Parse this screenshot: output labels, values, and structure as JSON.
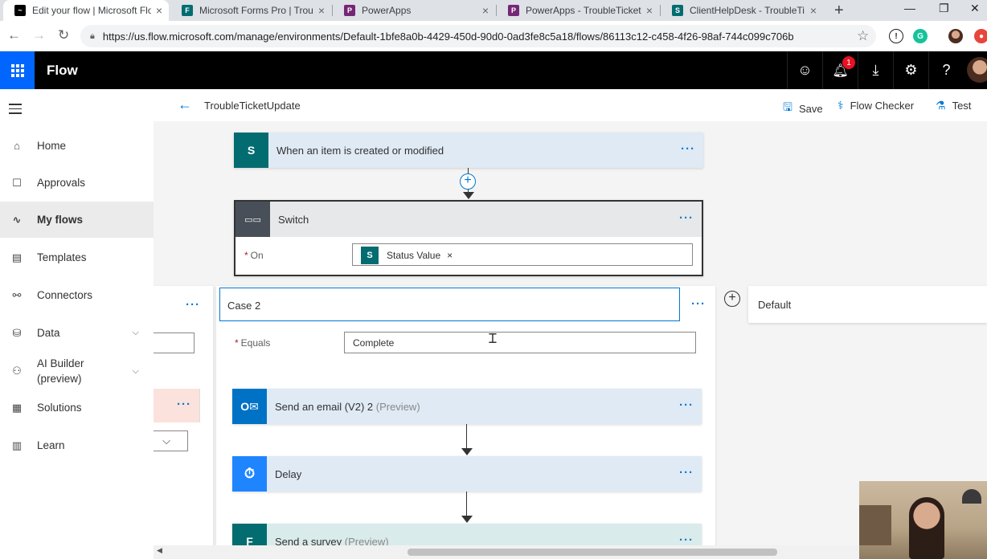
{
  "browser": {
    "tabs": [
      {
        "label": "Edit your flow | Microsoft Flow",
        "color": "#000000",
        "glyph": "~"
      },
      {
        "label": "Microsoft Forms Pro | Trouble",
        "color": "#036c70",
        "glyph": "F"
      },
      {
        "label": "PowerApps",
        "color": "#742774",
        "glyph": "P"
      },
      {
        "label": "PowerApps - TroubleTickets",
        "color": "#742774",
        "glyph": "P"
      },
      {
        "label": "ClientHelpDesk - TroubleTi",
        "color": "#036c70",
        "glyph": "S"
      }
    ],
    "url": "https://us.flow.microsoft.com/manage/environments/Default-1bfe8a0b-4429-450d-90d0-0ad3fe8c5a18/flows/86113c12-c458-4f26-98af-744c099c706b"
  },
  "header": {
    "app_name": "Flow",
    "notification_count": "1"
  },
  "nav": {
    "items": [
      {
        "label": "Home",
        "icon": "⌂"
      },
      {
        "label": "Approvals",
        "icon": "☐"
      },
      {
        "label": "My flows",
        "icon": "∿"
      },
      {
        "label": "Templates",
        "icon": "▤"
      },
      {
        "label": "Connectors",
        "icon": "⚯"
      },
      {
        "label": "Data",
        "icon": "⛁"
      },
      {
        "label": "AI Builder (preview)",
        "icon": "⚇"
      },
      {
        "label": "Solutions",
        "icon": "▦"
      },
      {
        "label": "Learn",
        "icon": "▥"
      }
    ]
  },
  "toolbar": {
    "flow_name": "TroubleTicketUpdate",
    "save": "Save",
    "flow_checker": "Flow Checker",
    "test": "Test"
  },
  "canvas": {
    "trigger": "When an item is created or modified",
    "switch": {
      "title": "Switch",
      "on_label": "On",
      "token": "Status Value"
    },
    "case2": {
      "title": "Case 2",
      "equals_label": "Equals",
      "equals_value": "Complete"
    },
    "default_title": "Default",
    "actions": [
      {
        "title": "Send an email (V2) 2",
        "suffix": "(Preview)",
        "color": "#0072c6"
      },
      {
        "title": "Delay",
        "suffix": "",
        "color": "#1f85ff"
      },
      {
        "title": "Send a survey",
        "suffix": "(Preview)",
        "color": "#036c70"
      }
    ]
  },
  "colors": {
    "accent": "#0078d4",
    "waffle": "#0066ff",
    "trigger_icon": "#036c70",
    "switch_icon": "#484f58"
  }
}
